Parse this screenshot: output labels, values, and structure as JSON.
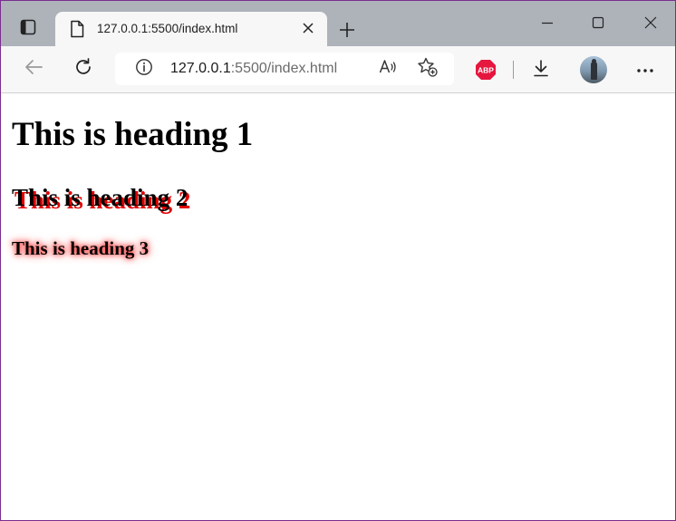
{
  "browser": {
    "tab": {
      "title": "127.0.0.1:5500/index.html",
      "favicon": "page-icon"
    },
    "address": {
      "host": "127.0.0.1",
      "path": ":5500/index.html"
    },
    "extensions": {
      "adblock_label": "ABP"
    },
    "icons": {
      "tab_actions": "tab-actions-icon",
      "close_tab": "close-icon",
      "new_tab": "plus-icon",
      "minimize": "minimize-icon",
      "maximize": "maximize-icon",
      "close_window": "close-icon",
      "back": "back-arrow-icon",
      "refresh": "refresh-icon",
      "site_info": "info-icon",
      "read_aloud": "read-aloud-icon",
      "favorites": "add-favorite-icon",
      "downloads": "download-icon",
      "more": "more-icon"
    },
    "colors": {
      "tabstrip": "#aeb3ba",
      "toolbar": "#f7f7f7",
      "adblock_red": "#e5173f"
    }
  },
  "page": {
    "h1": "This is heading 1",
    "h2": "This is heading 2",
    "h3": "This is heading 3",
    "colors": {
      "h2_shadow": "#e00000",
      "h3_glow": "#ff2020"
    }
  }
}
